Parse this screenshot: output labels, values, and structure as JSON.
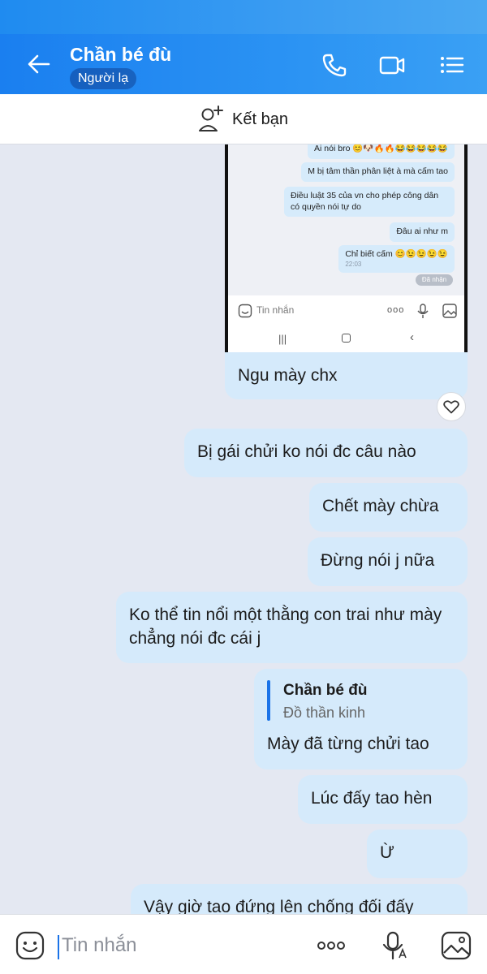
{
  "header": {
    "title": "Chần bé đù",
    "badge": "Người lạ"
  },
  "add_friend": {
    "label": "Kết bạn"
  },
  "screenshot": {
    "messages": [
      "Ai nói bro 😊🐶🔥🔥😂😂😂😂😂",
      "M bị tâm thần phân liệt à mà cấm tao",
      "Điều luật 35 của vn cho phép công dân có quyền nói tự do",
      "Đâu ai như m",
      "Chỉ biết cấm 😊😉😉😉😉"
    ],
    "time": "22:03",
    "status": "Đã nhận",
    "input_placeholder": "Tin nhắn"
  },
  "messages": [
    {
      "text": "Ngu mày chx"
    },
    {
      "text": "Bị gái chửi ko nói đc câu nào"
    },
    {
      "text": "Chết mày chừa"
    },
    {
      "text": "Đừng nói j nữa"
    },
    {
      "text": "Ko thể tin nổi một thằng con trai như mày chẳng nói đc cái j"
    },
    {
      "reply_name": "Chần bé đù",
      "reply_text": "Đồ thần kinh",
      "text": "Mày đã từng chửi tao"
    },
    {
      "text": "Lúc đấy tao hèn"
    },
    {
      "text": "Ừ"
    },
    {
      "text": "Vậy giờ tao đứng lên chống đối đấy"
    }
  ],
  "composer": {
    "placeholder": "Tin nhắn"
  },
  "colors": {
    "header": "#1a7ff0",
    "bubble": "#d5eafb",
    "background": "#e4e8f2",
    "accent": "#1a73e8"
  },
  "icons": [
    "back-arrow-icon",
    "phone-icon",
    "video-call-icon",
    "menu-list-icon",
    "add-friend-icon",
    "heart-icon",
    "emoji-icon",
    "more-dots-icon",
    "voice-to-text-icon",
    "image-icon"
  ]
}
